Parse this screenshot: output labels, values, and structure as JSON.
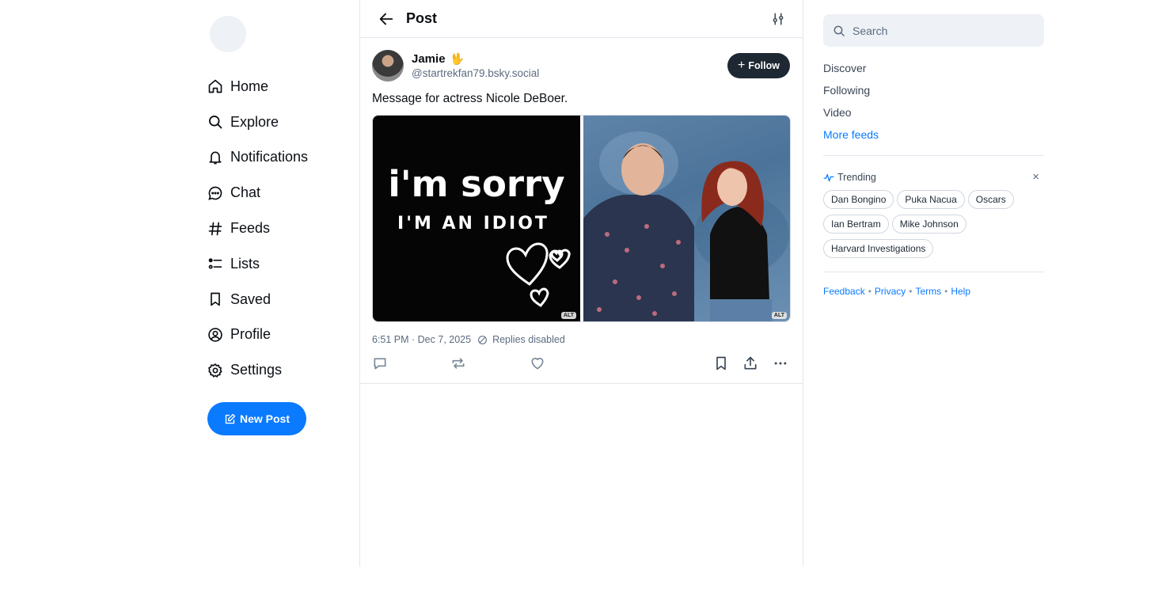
{
  "nav": {
    "items": [
      {
        "key": "home",
        "label": "Home",
        "icon": "home-icon"
      },
      {
        "key": "explore",
        "label": "Explore",
        "icon": "search-icon"
      },
      {
        "key": "notifications",
        "label": "Notifications",
        "icon": "bell-icon"
      },
      {
        "key": "chat",
        "label": "Chat",
        "icon": "chat-bubble-icon"
      },
      {
        "key": "feeds",
        "label": "Feeds",
        "icon": "hashtag-icon"
      },
      {
        "key": "lists",
        "label": "Lists",
        "icon": "list-icon"
      },
      {
        "key": "saved",
        "label": "Saved",
        "icon": "bookmark-icon"
      },
      {
        "key": "profile",
        "label": "Profile",
        "icon": "user-circle-icon"
      },
      {
        "key": "settings",
        "label": "Settings",
        "icon": "gear-icon"
      }
    ],
    "new_post_label": "New Post"
  },
  "header": {
    "title": "Post"
  },
  "post": {
    "author": {
      "display_name": "Jamie",
      "emoji": "🖖",
      "handle": "@startrekfan79.bsky.social"
    },
    "follow_label": "Follow",
    "text": "Message for actress Nicole DeBoer.",
    "images": [
      {
        "alt_badge": "ALT",
        "line1": "i'm sorry",
        "line2": "I'M AN IDIOT"
      },
      {
        "alt_badge": "ALT"
      }
    ],
    "timestamp": "6:51 PM · Dec 7, 2025",
    "replies_status": "Replies disabled"
  },
  "right": {
    "search_placeholder": "Search",
    "feeds": [
      "Discover",
      "Following",
      "Video",
      "More feeds"
    ],
    "trending": {
      "title": "Trending",
      "close": "×",
      "topics": [
        "Dan Bongino",
        "Puka Nacua",
        "Oscars",
        "Ian Bertram",
        "Mike Johnson",
        "Harvard Investigations"
      ]
    },
    "footer": [
      "Feedback",
      "Privacy",
      "Terms",
      "Help"
    ]
  },
  "colors": {
    "accent": "#0a7aff",
    "follow_bg": "#1e2833",
    "muted_text": "#5b6b7f",
    "border": "#e2e7ee"
  }
}
